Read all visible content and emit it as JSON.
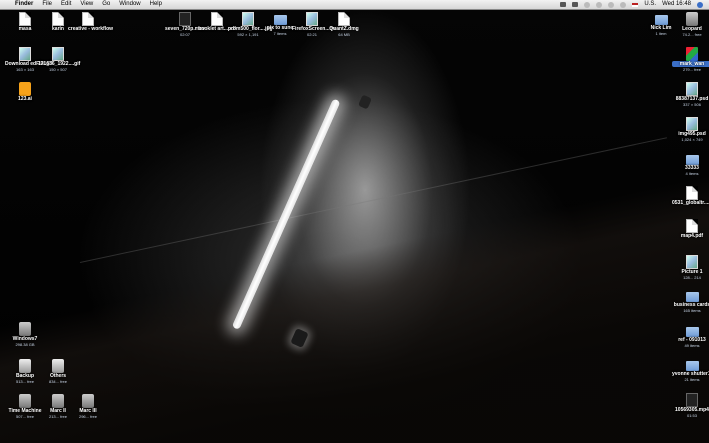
{
  "menubar": {
    "apple": "",
    "items": [
      "Finder",
      "File",
      "Edit",
      "View",
      "Go",
      "Window",
      "Help"
    ],
    "input_source": "U.S.",
    "clock": "Wed 16:48"
  },
  "desktop_icons": [
    {
      "name": "masa",
      "sub": "",
      "kind": "doc",
      "id": "masa"
    },
    {
      "name": "karin",
      "sub": "",
      "kind": "doc",
      "id": "karin"
    },
    {
      "name": "creative - workflow",
      "sub": "",
      "kind": "doc",
      "id": "creative-workflow"
    },
    {
      "name": "Download edFile.gif",
      "sub": "163 × 163",
      "kind": "img",
      "id": "downloadedfile"
    },
    {
      "name": "171636_1922....gif",
      "sub": "150 × 507",
      "kind": "img",
      "id": "gif-171636"
    },
    {
      "name": "123.ai",
      "sub": "",
      "kind": "ai",
      "id": "ai-123"
    },
    {
      "name": "seven_720p.mov",
      "sub": "02:07",
      "kind": "film",
      "id": "seven-mov"
    },
    {
      "name": "booklet art...pdf",
      "sub": "",
      "kind": "doc",
      "id": "booklet-pdf"
    },
    {
      "name": "prom500_flor....jpg",
      "sub": "592 × 1,191",
      "kind": "img",
      "id": "prom-jpg"
    },
    {
      "name": "pix to sune",
      "sub": "7 items",
      "kind": "folder",
      "id": "pix-to-sune"
    },
    {
      "name": "FirefoxScreen...dv",
      "sub": "02:21",
      "kind": "img",
      "id": "firefox-dv"
    },
    {
      "name": "QuantZ.dmg",
      "sub": "64 MB",
      "kind": "doc",
      "id": "quantz-dmg"
    },
    {
      "name": "Nick Lim",
      "sub": "1 item",
      "kind": "folder",
      "id": "nick-lim"
    },
    {
      "name": "Leopard",
      "sub": "74.2... free",
      "kind": "disk",
      "id": "leopard"
    },
    {
      "name": "mark_wan",
      "sub": "279... free",
      "kind": "cube",
      "id": "mark-wan"
    },
    {
      "name": "88387137.psd",
      "sub": "337 × 506",
      "kind": "img",
      "id": "psd-88387137"
    },
    {
      "name": "img495.psd",
      "sub": "1,024 × 749",
      "kind": "img",
      "id": "img495-psd"
    },
    {
      "name": "33333",
      "sub": "4 items",
      "kind": "folder",
      "id": "folder-33333"
    },
    {
      "name": "0531_globaltr....pdf",
      "sub": "",
      "kind": "doc",
      "id": "globaltr-pdf"
    },
    {
      "name": "map4.pdf",
      "sub": "",
      "kind": "doc",
      "id": "map4-pdf"
    },
    {
      "name": "Picture 1",
      "sub": "128... 214",
      "kind": "img",
      "id": "picture-1"
    },
    {
      "name": "business cards",
      "sub": "165 items",
      "kind": "folder",
      "id": "business-cards"
    },
    {
      "name": "ref - 091013",
      "sub": "49 items",
      "kind": "folder",
      "id": "ref-091013"
    },
    {
      "name": "yvonne shutter1.tocc",
      "sub": "21 items",
      "kind": "folder",
      "id": "yvonne-shutter"
    },
    {
      "name": "10569305.mp4",
      "sub": "01:53",
      "kind": "film",
      "id": "mp4-10569305"
    },
    {
      "name": "Windows7",
      "sub": "298.38 GB",
      "kind": "disk",
      "id": "windows7"
    },
    {
      "name": "Backup",
      "sub": "513... free",
      "kind": "dmg",
      "id": "backup"
    },
    {
      "name": "Others",
      "sub": "834... free",
      "kind": "dmg",
      "id": "others"
    },
    {
      "name": "Time Machine",
      "sub": "507... free",
      "kind": "disk",
      "id": "time-machine"
    },
    {
      "name": "Marc II",
      "sub": "213... free",
      "kind": "disk",
      "id": "marc-ii"
    },
    {
      "name": "Marc III",
      "sub": "296... free",
      "kind": "disk",
      "id": "marc-iii"
    }
  ]
}
